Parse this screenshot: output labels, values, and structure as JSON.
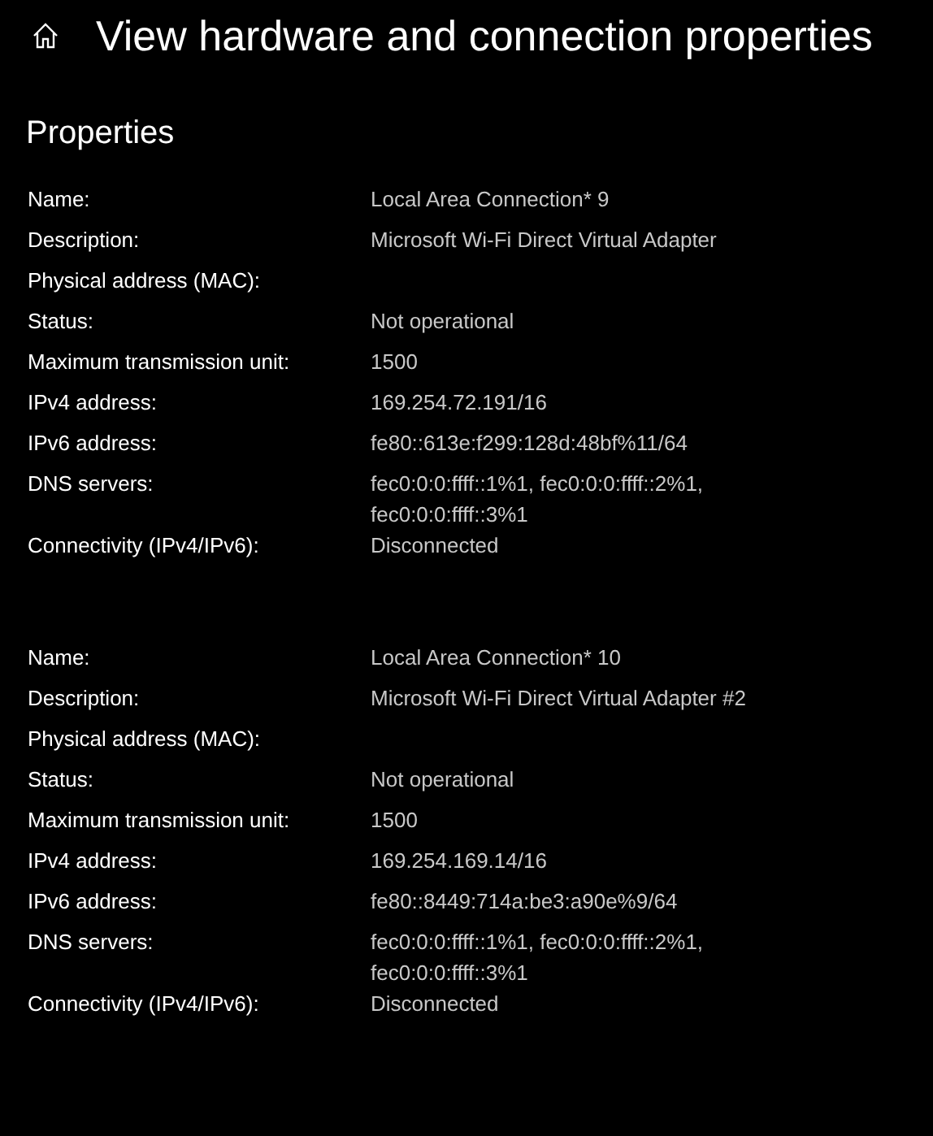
{
  "header": {
    "title": "View hardware and connection properties"
  },
  "section_title": "Properties",
  "adapters": [
    {
      "rows": [
        {
          "label": "Name:",
          "value": "Local Area Connection* 9"
        },
        {
          "label": "Description:",
          "value": "Microsoft Wi-Fi Direct Virtual Adapter"
        },
        {
          "label": "Physical address (MAC):"
        },
        {
          "label": "Status:",
          "value": "Not operational"
        },
        {
          "label": "Maximum transmission unit:",
          "value": "1500"
        },
        {
          "label": "IPv4 address:",
          "value": "169.254.72.191/16"
        },
        {
          "label": "IPv6 address:",
          "value": "fe80::613e:f299:128d:48bf%11/64"
        },
        {
          "label": "DNS servers:",
          "value": "fec0:0:0:ffff::1%1, fec0:0:0:ffff::2%1, fec0:0:0:ffff::3%1"
        },
        {
          "label": "Connectivity (IPv4/IPv6):",
          "value": "Disconnected"
        }
      ]
    },
    {
      "rows": [
        {
          "label": "Name:",
          "value": "Local Area Connection* 10"
        },
        {
          "label": "Description:",
          "value": "Microsoft Wi-Fi Direct Virtual Adapter #2"
        },
        {
          "label": "Physical address (MAC):"
        },
        {
          "label": "Status:",
          "value": "Not operational"
        },
        {
          "label": "Maximum transmission unit:",
          "value": "1500"
        },
        {
          "label": "IPv4 address:",
          "value": "169.254.169.14/16"
        },
        {
          "label": "IPv6 address:",
          "value": "fe80::8449:714a:be3:a90e%9/64"
        },
        {
          "label": "DNS servers:",
          "value": "fec0:0:0:ffff::1%1, fec0:0:0:ffff::2%1, fec0:0:0:ffff::3%1"
        },
        {
          "label": "Connectivity (IPv4/IPv6):",
          "value": "Disconnected"
        }
      ]
    }
  ]
}
